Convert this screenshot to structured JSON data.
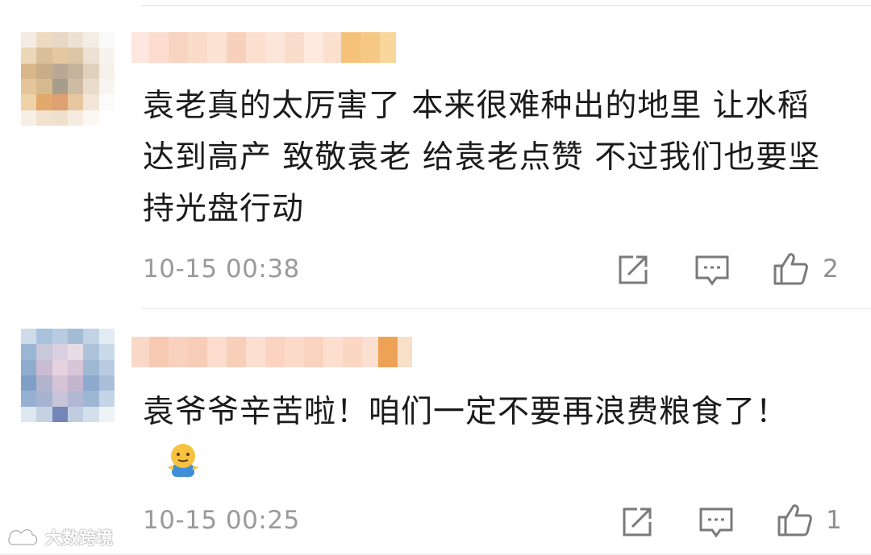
{
  "comments": [
    {
      "text": "袁老真的太厉害了 本来很难种出的地里 让水稻达到高产 致敬袁老 给袁老点赞 不过我们也要坚持光盘行动",
      "timestamp": "10-15 00:38",
      "like_count": "2",
      "emoji": ""
    },
    {
      "text": "袁爷爷辛苦啦！咱们一定不要再浪费粮食了！",
      "timestamp": "10-15 00:25",
      "like_count": "1",
      "emoji": "smiling-face-emoji"
    }
  ],
  "icons": {
    "repost": "repost-icon",
    "comment": "comment-icon",
    "like": "thumbs-up-icon"
  },
  "watermark": {
    "text": "大数跨境"
  },
  "colors": {
    "text": "#1b1b1b",
    "meta": "#9a9a9a",
    "icon": "#7a7a7a",
    "divider": "#efefef"
  }
}
